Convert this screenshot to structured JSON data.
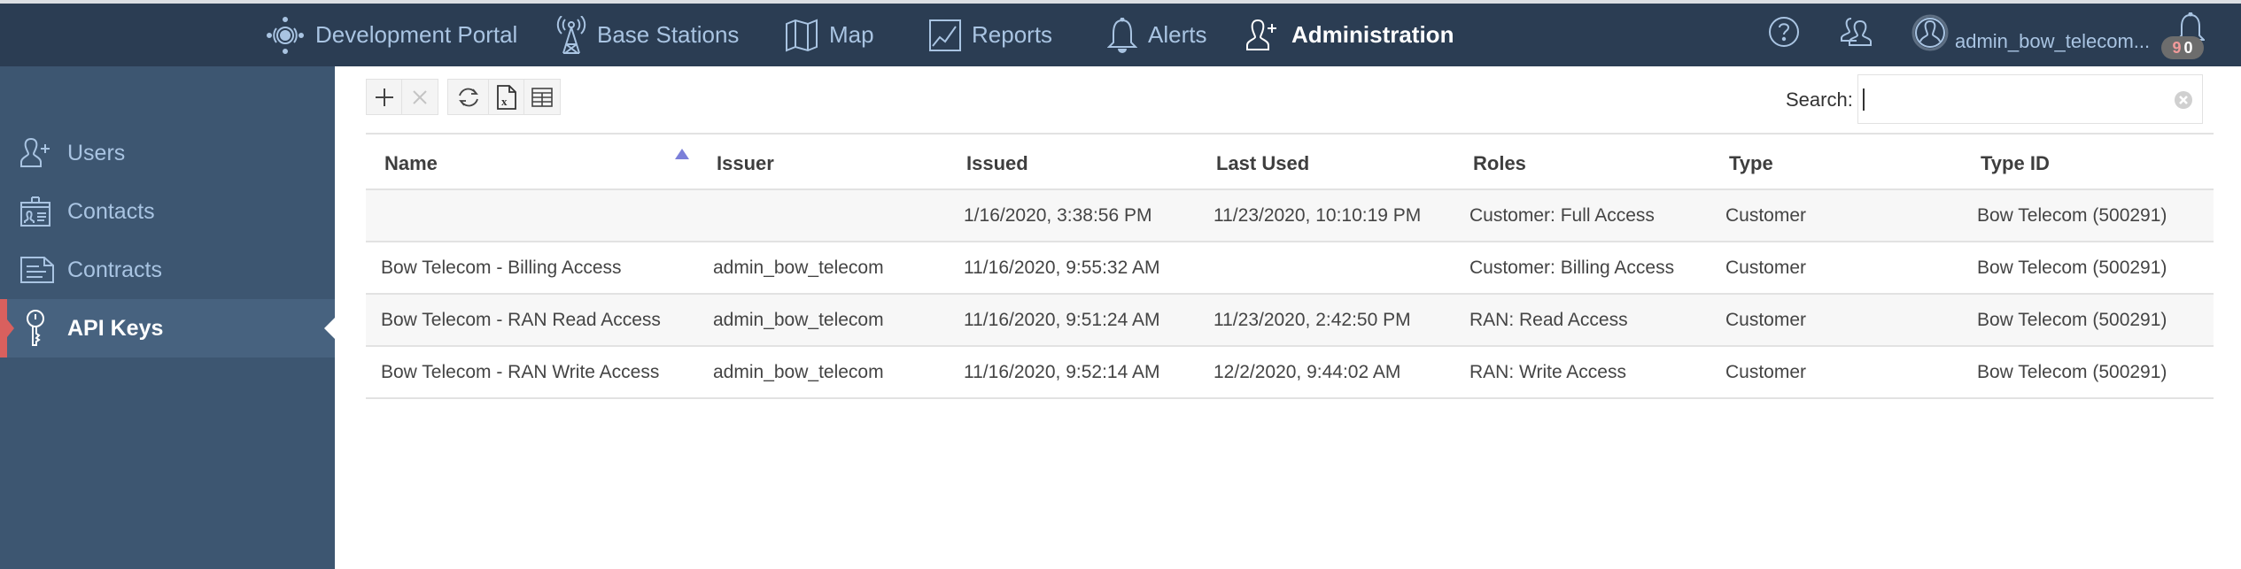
{
  "topnav": {
    "items": [
      {
        "label": "Development Portal",
        "icon": "development-portal-icon"
      },
      {
        "label": "Base Stations",
        "icon": "base-station-tower-icon"
      },
      {
        "label": "Map",
        "icon": "map-icon"
      },
      {
        "label": "Reports",
        "icon": "reports-chart-icon"
      },
      {
        "label": "Alerts",
        "icon": "bell-icon"
      },
      {
        "label": "Administration",
        "icon": "user-add-icon",
        "active": true
      }
    ],
    "help_icon": "help-icon",
    "groups_icon": "users-group-icon",
    "avatar_icon": "user-avatar-icon",
    "username": "admin_bow_telecom...",
    "notifications": {
      "icon": "bell-icon",
      "count_red": "9",
      "count_white": "0"
    }
  },
  "sidebar": {
    "items": [
      {
        "label": "Users",
        "icon": "user-add-icon"
      },
      {
        "label": "Contacts",
        "icon": "contact-card-icon"
      },
      {
        "label": "Contracts",
        "icon": "document-icon"
      },
      {
        "label": "API Keys",
        "icon": "key-icon",
        "active": true
      }
    ]
  },
  "toolbar": {
    "add": "add-icon",
    "delete": "delete-icon",
    "refresh": "refresh-icon",
    "export_excel": "excel-export-icon",
    "columns": "table-columns-icon"
  },
  "search": {
    "label": "Search:",
    "value": "",
    "placeholder": ""
  },
  "table": {
    "columns": [
      "Name",
      "Issuer",
      "Issued",
      "Last Used",
      "Roles",
      "Type",
      "Type ID"
    ],
    "sort": {
      "column": "Name",
      "direction": "ascending"
    },
    "rows": [
      {
        "name": "",
        "issuer": "",
        "issued": "1/16/2020, 3:38:56 PM",
        "last_used": "11/23/2020, 10:10:19 PM",
        "roles": "Customer: Full Access",
        "type": "Customer",
        "type_id": "Bow Telecom (500291)"
      },
      {
        "name": "Bow Telecom - Billing Access",
        "issuer": "admin_bow_telecom",
        "issued": "11/16/2020, 9:55:32 AM",
        "last_used": "",
        "roles": "Customer: Billing Access",
        "type": "Customer",
        "type_id": "Bow Telecom (500291)"
      },
      {
        "name": "Bow Telecom - RAN Read Access",
        "issuer": "admin_bow_telecom",
        "issued": "11/16/2020, 9:51:24 AM",
        "last_used": "11/23/2020, 2:42:50 PM",
        "roles": "RAN: Read Access",
        "type": "Customer",
        "type_id": "Bow Telecom (500291)"
      },
      {
        "name": "Bow Telecom - RAN Write Access",
        "issuer": "admin_bow_telecom",
        "issued": "11/16/2020, 9:52:14 AM",
        "last_used": "12/2/2020, 9:44:02 AM",
        "roles": "RAN: Write Access",
        "type": "Customer",
        "type_id": "Bow Telecom (500291)"
      }
    ]
  },
  "colors": {
    "topbar": "#2b3d53",
    "sidebar": "#3d5671",
    "sidebar_active": "#47627f",
    "active_accent": "#d9605e",
    "nav_text": "#a9c4e2",
    "sort_indicator": "#7b7fd9"
  }
}
